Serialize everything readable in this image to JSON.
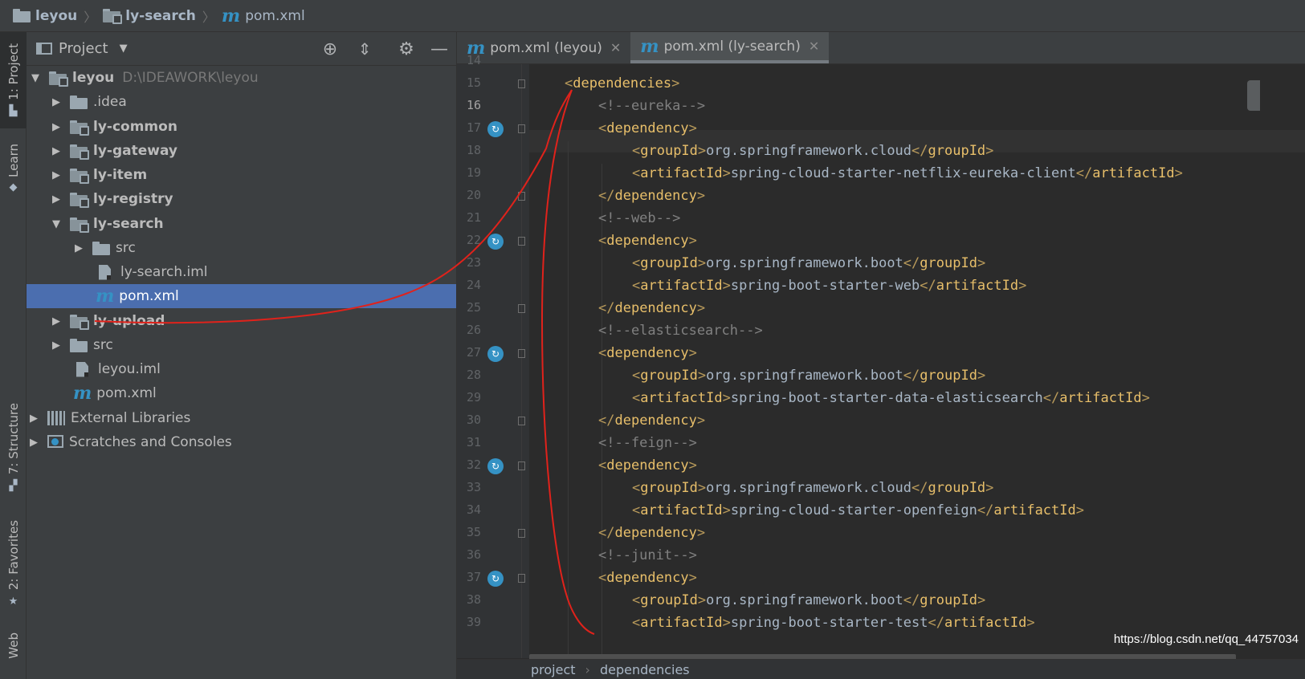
{
  "breadcrumb": {
    "items": [
      {
        "label": "leyou",
        "icon": "folder-icon"
      },
      {
        "label": "ly-search",
        "icon": "module-folder-icon"
      },
      {
        "label": "pom.xml",
        "icon": "maven-icon"
      }
    ]
  },
  "toolstrip": {
    "tabs": [
      {
        "label": "1: Project",
        "active": true
      },
      {
        "label": "Learn"
      },
      {
        "label": "7: Structure"
      },
      {
        "label": "2: Favorites"
      },
      {
        "label": "Web"
      }
    ]
  },
  "project": {
    "title": "Project",
    "tree": [
      {
        "name": "leyou",
        "path": "D:\\IDEAWORK\\leyou",
        "bold": true,
        "expanded": true
      },
      {
        "name": ".idea"
      },
      {
        "name": "ly-common",
        "bold": true
      },
      {
        "name": "ly-gateway",
        "bold": true
      },
      {
        "name": "ly-item",
        "bold": true
      },
      {
        "name": "ly-registry",
        "bold": true
      },
      {
        "name": "ly-search",
        "bold": true,
        "expanded": true
      },
      {
        "name": "src"
      },
      {
        "name": "ly-search.iml"
      },
      {
        "name": "pom.xml",
        "selected": true
      },
      {
        "name": "ly-upload",
        "bold": true
      },
      {
        "name": "src"
      },
      {
        "name": "leyou.iml"
      },
      {
        "name": "pom.xml"
      },
      {
        "name": "External Libraries"
      },
      {
        "name": "Scratches and Consoles"
      }
    ]
  },
  "editor": {
    "tabs": [
      {
        "label": "pom.xml (leyou)",
        "active": false
      },
      {
        "label": "pom.xml (ly-search)",
        "active": true
      }
    ],
    "current_line": 16,
    "line_numbers": [
      "14",
      "15",
      "16",
      "17",
      "18",
      "19",
      "20",
      "21",
      "22",
      "23",
      "24",
      "25",
      "26",
      "27",
      "28",
      "29",
      "30",
      "31",
      "32",
      "33",
      "34",
      "35",
      "36",
      "37",
      "38",
      "39"
    ],
    "lines": [
      {
        "open": "<",
        "tag": "dependencies",
        "close": ">"
      },
      {
        "comment": "<!--eureka-->"
      },
      {
        "open": "<",
        "tag": "dependency",
        "close": ">"
      },
      {
        "tag": "groupId",
        "value": "org.springframework.cloud"
      },
      {
        "tag": "artifactId",
        "value": "spring-cloud-starter-netflix-eureka-client"
      },
      {
        "open": "</",
        "tag": "dependency",
        "close": ">"
      },
      {
        "comment": "<!--web-->"
      },
      {
        "open": "<",
        "tag": "dependency",
        "close": ">"
      },
      {
        "tag": "groupId",
        "value": "org.springframework.boot"
      },
      {
        "tag": "artifactId",
        "value": "spring-boot-starter-web"
      },
      {
        "open": "</",
        "tag": "dependency",
        "close": ">"
      },
      {
        "comment": "<!--elasticsearch-->"
      },
      {
        "open": "<",
        "tag": "dependency",
        "close": ">"
      },
      {
        "tag": "groupId",
        "value": "org.springframework.boot"
      },
      {
        "tag": "artifactId",
        "value": "spring-boot-starter-data-elasticsearch"
      },
      {
        "open": "</",
        "tag": "dependency",
        "close": ">"
      },
      {
        "comment": "<!--feign-->"
      },
      {
        "open": "<",
        "tag": "dependency",
        "close": ">"
      },
      {
        "tag": "groupId",
        "value": "org.springframework.cloud"
      },
      {
        "tag": "artifactId",
        "value": "spring-cloud-starter-openfeign"
      },
      {
        "open": "</",
        "tag": "dependency",
        "close": ">"
      },
      {
        "comment": "<!--junit-->"
      },
      {
        "open": "<",
        "tag": "dependency",
        "close": ">"
      },
      {
        "tag": "groupId",
        "value": "org.springframework.boot"
      },
      {
        "tag": "artifactId",
        "value": "spring-boot-starter-test"
      }
    ],
    "status_breadcrumb": [
      "project",
      "dependencies"
    ]
  },
  "watermark": "https://blog.csdn.net/qq_44757034",
  "colors": {
    "tag": "#e8bf6a",
    "text": "#a9b7c6",
    "comment": "#808080",
    "selection": "#4b6eaf",
    "annotation": "#e0221b"
  }
}
